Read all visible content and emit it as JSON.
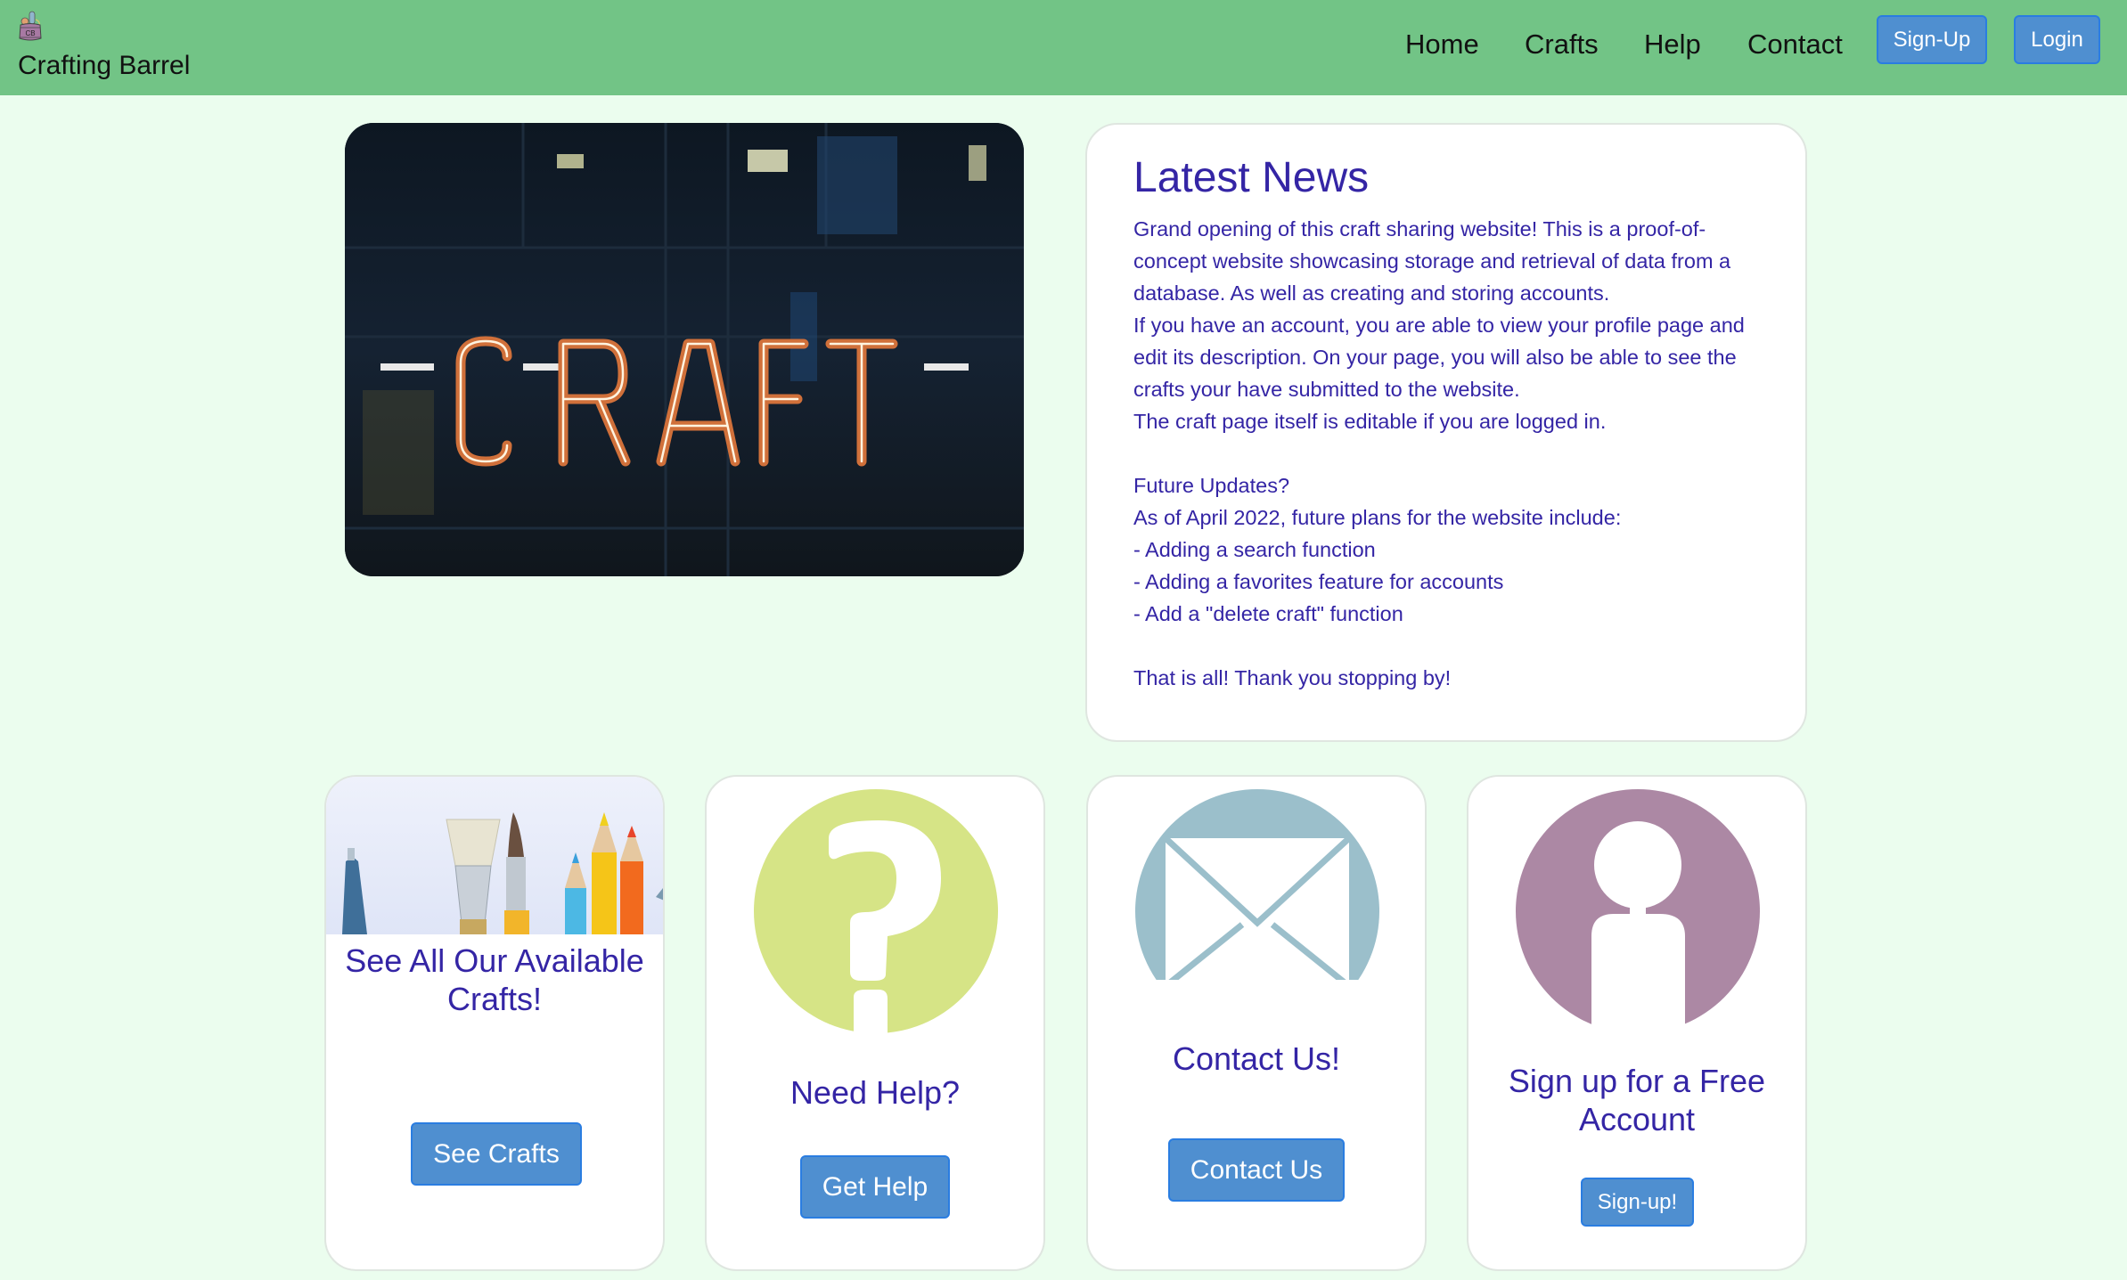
{
  "header": {
    "brand_name": "Crafting Barrel",
    "logo_text": "CB",
    "nav": [
      "Home",
      "Crafts",
      "Help",
      "Contact"
    ],
    "signup_label": "Sign-Up",
    "login_label": "Login"
  },
  "hero": {
    "image_text": "CRAFT"
  },
  "news": {
    "title": "Latest News",
    "lines": [
      "Grand opening of this craft sharing website! This is a proof-of-concept website showcasing storage and retrieval of data from a database. As well as creating and storing accounts.",
      "If you have an account, you are able to view your profile page and edit its description. On your page, you will also be able to see the crafts your have submitted to the website.",
      "The craft page itself is editable if you are logged in.",
      "",
      "Future Updates?",
      "As of April 2022, future plans for the website include:",
      "- Adding a search function",
      "- Adding a favorites feature for accounts",
      "- Add a \"delete craft\" function",
      "",
      "That is all! Thank you stopping by!"
    ]
  },
  "cards": [
    {
      "title": "See All Our Available Crafts!",
      "button": "See Crafts",
      "icon": "art-supplies-image"
    },
    {
      "title": "Need Help?",
      "button": "Get Help",
      "icon": "question-mark-icon",
      "icon_color": "#d6e486"
    },
    {
      "title": "Contact Us!",
      "button": "Contact Us",
      "icon": "envelope-icon",
      "icon_color": "#9bbfcb"
    },
    {
      "title": "Sign up for a Free Account",
      "button": "Sign-up!",
      "icon": "user-icon",
      "icon_color": "#ac88a4"
    }
  ],
  "colors": {
    "header_bg": "#72c486",
    "page_bg": "#ebfdee",
    "button_bg": "#4f8fd0",
    "text_accent": "#3425a5"
  }
}
